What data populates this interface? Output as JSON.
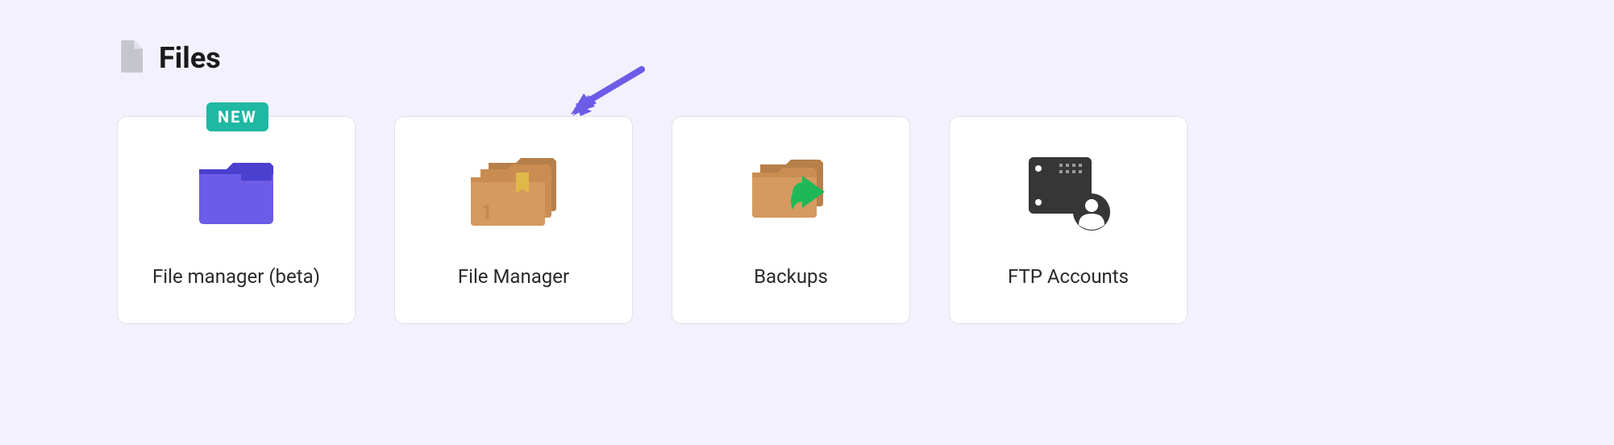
{
  "section": {
    "title": "Files"
  },
  "cards": [
    {
      "label": "File manager (beta)",
      "badge": "NEW"
    },
    {
      "label": "File Manager"
    },
    {
      "label": "Backups"
    },
    {
      "label": "FTP Accounts"
    }
  ]
}
